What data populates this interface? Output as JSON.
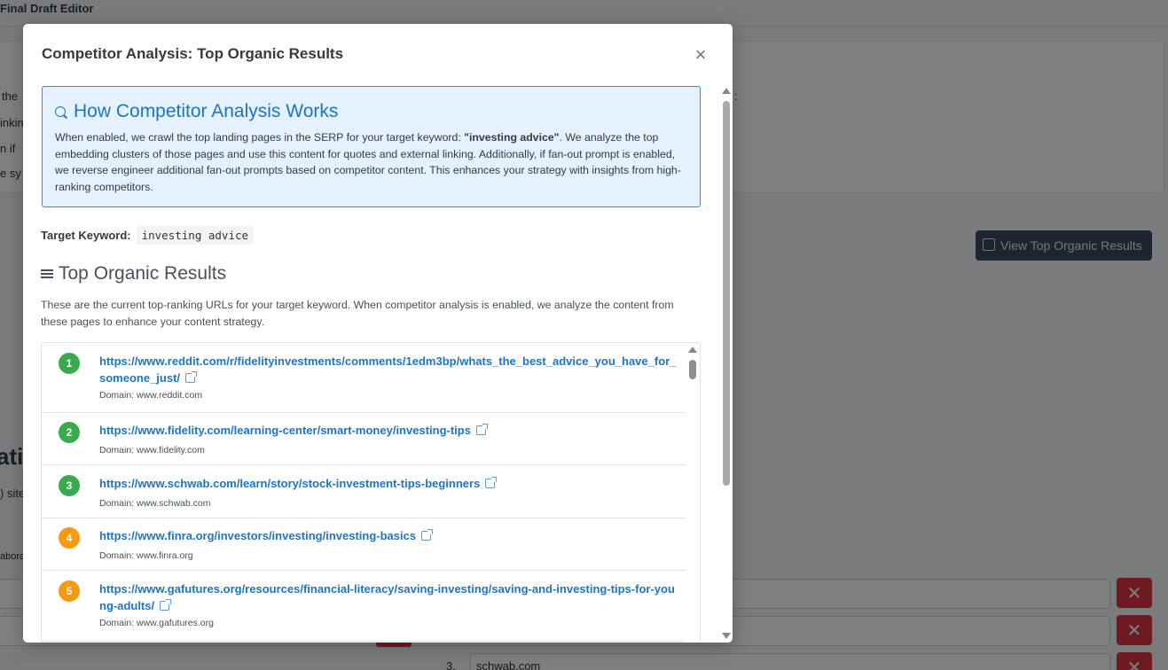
{
  "background": {
    "app_title": "Final Draft Editor",
    "fragments": [
      "the",
      "inkin",
      "n if",
      "e sy",
      ":",
      "ati",
      ") site",
      "abora"
    ],
    "view_button": "View Top Organic Results",
    "row_number": "3.",
    "row_value": "schwab.com",
    "delete_label": "✕"
  },
  "modal": {
    "title": "Competitor Analysis: Top Organic Results",
    "close_label": "×",
    "info": {
      "heading": "How Competitor Analysis Works",
      "text_before": "When enabled, we crawl the top landing pages in the SERP for your target keyword: ",
      "keyword_bold": "\"investing advice\"",
      "text_after": ". We analyze the top embedding clusters of those pages and use this content for quotes and external linking. Additionally, if fan-out prompt is enabled, we reverse engineer additional fan-out prompts based on competitor content. This enhances your strategy with insights from high-ranking competitors."
    },
    "target_keyword_label": "Target Keyword:",
    "target_keyword_value": "investing advice",
    "results_heading": "Top Organic Results",
    "results_desc": "These are the current top-ranking URLs for your target keyword. When competitor analysis is enabled, we analyze the content from these pages to enhance your content strategy.",
    "domain_prefix": "Domain:",
    "colors": {
      "rank_green": "#3aaa4f",
      "rank_orange": "#f59a12",
      "link": "#1f74c4"
    },
    "results": [
      {
        "rank": "1",
        "url": "https://www.reddit.com/r/fidelityinvestments/comments/1edm3bp/whats_the_best_advice_you_have_for_someone_just/",
        "domain": "Domain: www.reddit.com",
        "color": "#3aaa4f"
      },
      {
        "rank": "2",
        "url": "https://www.fidelity.com/learning-center/smart-money/investing-tips",
        "domain": "Domain: www.fidelity.com",
        "color": "#3aaa4f"
      },
      {
        "rank": "3",
        "url": "https://www.schwab.com/learn/story/stock-investment-tips-beginners",
        "domain": "Domain: www.schwab.com",
        "color": "#3aaa4f"
      },
      {
        "rank": "4",
        "url": "https://www.finra.org/investors/investing/investing-basics",
        "domain": "Domain: www.finra.org",
        "color": "#f59a12"
      },
      {
        "rank": "5",
        "url": "https://www.gafutures.org/resources/financial-literacy/saving-investing/saving-and-investing-tips-for-young-adults/",
        "domain": "Domain: www.gafutures.org",
        "color": "#f59a12"
      }
    ]
  }
}
